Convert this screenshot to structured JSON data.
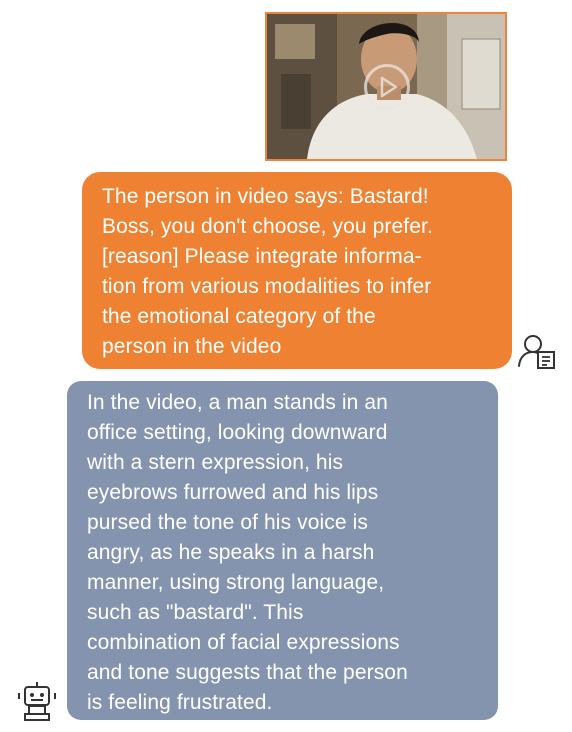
{
  "video": {
    "thumbnail_icon": "video-frame",
    "play_icon": "play-icon"
  },
  "user_message": {
    "text": "The person in video says: Bastard!\nBoss, you don't choose, you prefer.\n[reason] Please integrate informa-\ntion from various modalities to infer\nthe emotional category of the\nperson in the video",
    "avatar_icon": "user-icon"
  },
  "assistant_message": {
    "text": "In the video, a man stands in an\noffice setting, looking downward\nwith a stern expression, his\neyebrows furrowed and his lips\npursed the tone of his voice is\nangry, as he speaks in a harsh\nmanner, using strong language,\nsuch as \"bastard\".  This\ncombination of facial expressions\nand tone suggests that the person\nis feeling frustrated.",
    "avatar_icon": "robot-icon"
  },
  "colors": {
    "user_bubble": "#ee8232",
    "assistant_bubble": "#8494ae",
    "video_border": "#e8873a"
  }
}
